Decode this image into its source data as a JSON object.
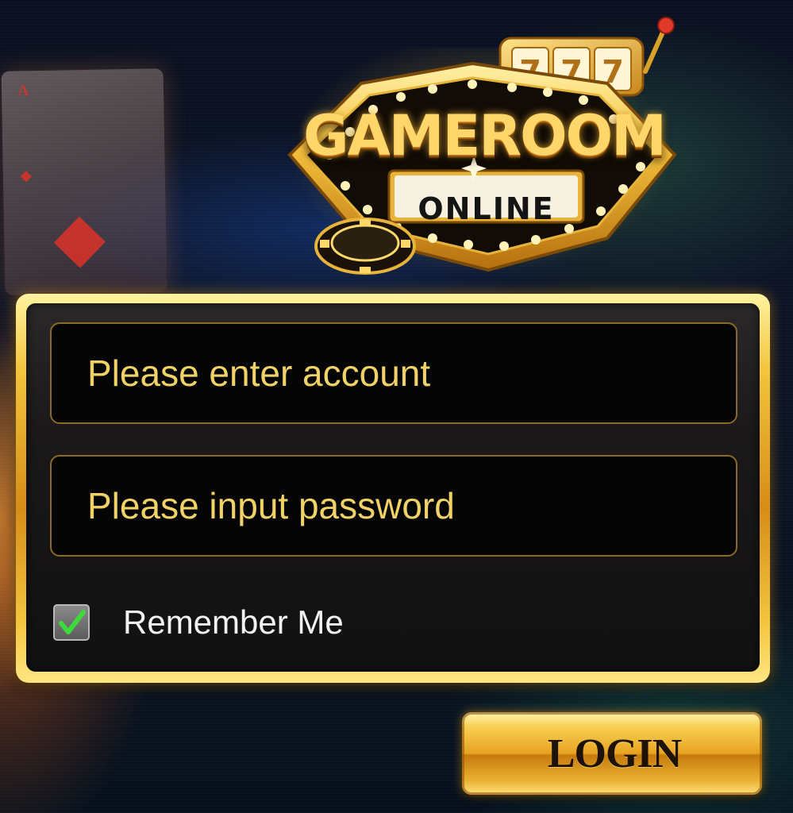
{
  "logo": {
    "title": "GAMEROOM",
    "subtitle": "ONLINE",
    "reel_symbols": [
      "7",
      "7",
      "7"
    ]
  },
  "background": {
    "card_rank": "A",
    "card_suit": "diamond"
  },
  "login_form": {
    "account_placeholder": "Please enter account",
    "account_value": "",
    "password_placeholder": "Please input password",
    "password_value": "",
    "remember_label": "Remember Me",
    "remember_checked": true,
    "login_button_label": "LOGIN"
  },
  "icons": {
    "check": "check-icon",
    "slot_machine": "slot-machine-icon",
    "casino_chip": "casino-chip-icon"
  },
  "colors": {
    "gold": "#f3c43c",
    "placeholder_text": "#f0d266",
    "panel_bg": "#1a1818",
    "check_green": "#3ed93a"
  }
}
